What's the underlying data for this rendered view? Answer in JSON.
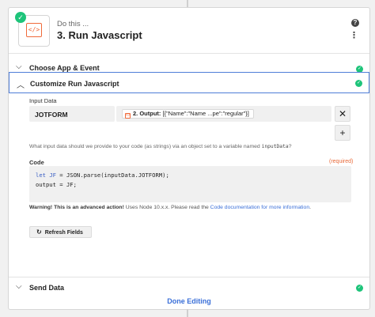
{
  "step": {
    "subtitle": "Do this ...",
    "title": "3. Run Javascript",
    "app_icon": "code-icon",
    "app_icon_glyph": "</>"
  },
  "header_icons": {
    "help": "?",
    "more": "⋮"
  },
  "sections": {
    "choose": "Choose App & Event",
    "customize": "Customize Run Javascript",
    "send": "Send Data"
  },
  "input_data": {
    "label": "Input Data",
    "key": "JOTFORM",
    "value_step": "2. Output:",
    "value_text": "[{\"Name\":\"Name ...pe\":\"regular\"}]",
    "help_prefix": "What input data should we provide to your code (as strings) via an object set to a variable named ",
    "help_var": "inputData",
    "help_suffix": "?"
  },
  "code": {
    "label": "Code",
    "required": "(required)",
    "line1_kw": "let",
    "line1_var": "JF",
    "line1_rest": " = JSON.parse(inputData.JOTFORM);",
    "line2": "output = JF;"
  },
  "warning": {
    "bold": "Warning! This is an advanced action!",
    "text": " Uses Node 10.x.x. Please read the ",
    "link": "Code documentation for more information",
    "end": "."
  },
  "refresh_label": "Refresh Fields",
  "done_label": "Done Editing",
  "colors": {
    "accent": "#3a6fd8",
    "success": "#1ec47a",
    "brand": "#f06a3a",
    "required": "#e86a3a"
  }
}
